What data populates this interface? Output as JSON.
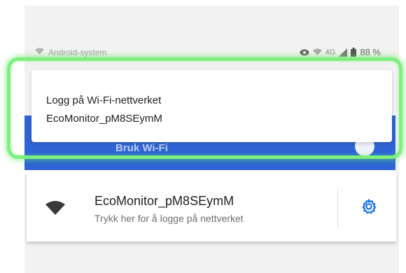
{
  "status_bar": {
    "app_label": "Android-system",
    "network_type": "4G",
    "battery": "88 %"
  },
  "background_card": {
    "label": "Bruk Wi-Fi"
  },
  "notification": {
    "title": "Logg på Wi-Fi-nettverket",
    "network_name": "EcoMonitor_pM8SEymM"
  },
  "network_item": {
    "name": "EcoMonitor_pM8SEymM",
    "subtitle": "Trykk her for å logge på nettverket"
  },
  "icons": {
    "status_wifi": "wifi-icon",
    "status_eye": "eye-icon",
    "status_signal": "signal-icon",
    "status_battery": "battery-icon",
    "network": "wifi-icon",
    "settings": "gear-icon"
  },
  "colors": {
    "accent_blue": "#2f64d6",
    "gear_blue": "#1a73e8",
    "highlight_green": "#7cf07c"
  }
}
